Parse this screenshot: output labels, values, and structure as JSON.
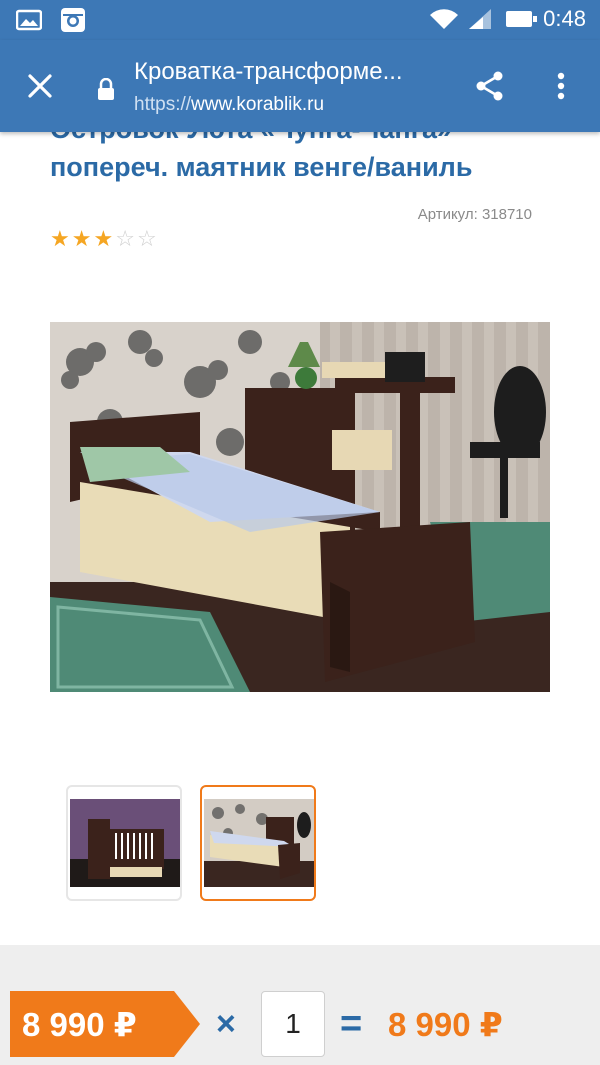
{
  "status_bar": {
    "time": "0:48",
    "icons": [
      "gallery-icon",
      "instagram-icon",
      "wifi-icon",
      "signal-icon",
      "battery-icon"
    ]
  },
  "browser": {
    "page_title": "Кроватка-трансформе...",
    "url_scheme": "https://",
    "url_host": "www.korablik.ru",
    "icons": [
      "close-icon",
      "lock-icon",
      "share-icon",
      "overflow-menu-icon"
    ]
  },
  "product": {
    "title_line1": "Островок Уюта «Чунга-Чанга»",
    "title_line2": "попереч. маятник венге/ваниль",
    "article": "Артикул: 318710",
    "rating": 3,
    "rating_max": 5,
    "stars": [
      "★",
      "★",
      "★",
      "☆",
      "☆"
    ]
  },
  "gallery": {
    "thumbnails": [
      {
        "label": "crib-photo",
        "active": false
      },
      {
        "label": "bed-photo",
        "active": true
      }
    ]
  },
  "cart": {
    "price": "8 990 ₽",
    "multiply": "×",
    "quantity": "1",
    "equals": "=",
    "total": "8 990 ₽"
  },
  "colors": {
    "brand_blue": "#3d78b6",
    "title_blue": "#2b6aa6",
    "accent_orange": "#f07a1a",
    "star": "#f5a623"
  }
}
